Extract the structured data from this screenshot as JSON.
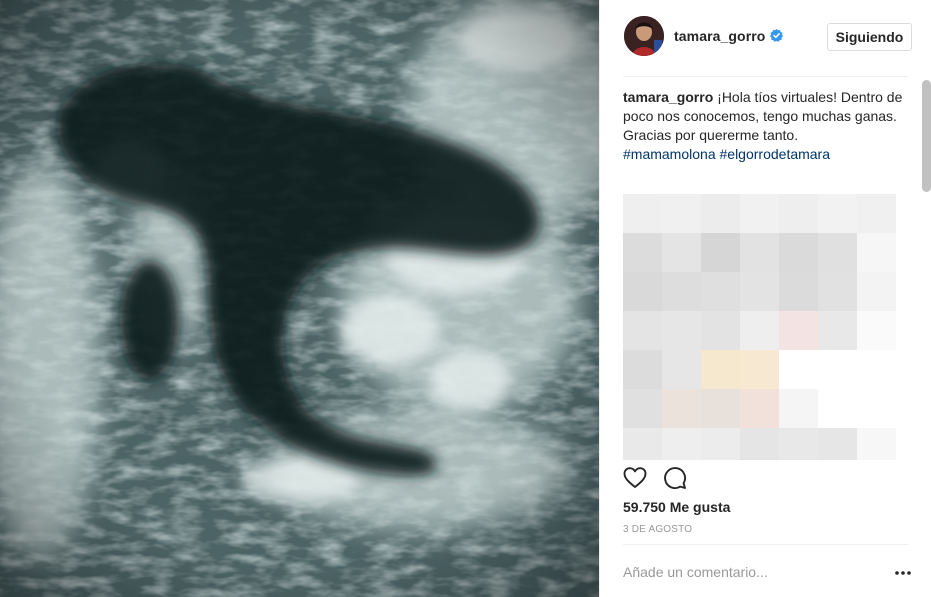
{
  "photo": {
    "icon": "ultrasound-photo"
  },
  "header": {
    "username": "tamara_gorro",
    "verified_icon": "verified-badge-icon",
    "follow_label": "Siguiendo"
  },
  "caption": {
    "username": "tamara_gorro",
    "text": "¡Hola tíos virtuales! Dentro de poco nos conocemos, tengo muchas ganas. Gracias por quererme tanto.",
    "hashtags": [
      "#mamamolona",
      "#elgorrodetamara"
    ]
  },
  "actions": {
    "like_icon": "heart-icon",
    "comment_icon": "comment-icon",
    "likes_text": "59.750 Me gusta",
    "date": "3 DE AGOSTO"
  },
  "comment_box": {
    "placeholder": "Añade un comentario...",
    "more_icon": "more-options-icon"
  },
  "colors": {
    "hashtag": "#003569",
    "verified": "#3897f0",
    "text": "#262626",
    "muted": "#999999",
    "border": "#efefef"
  }
}
